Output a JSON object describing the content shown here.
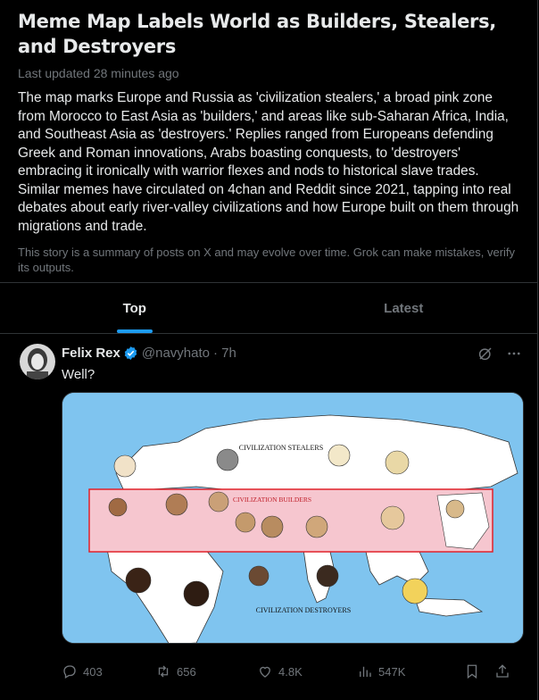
{
  "story": {
    "title": "Meme Map Labels World as Builders, Stealers, and Destroyers",
    "updated": "Last updated 28 minutes ago",
    "summary": "The map marks Europe and Russia as 'civilization stealers,' a broad pink zone from Morocco to East Asia as 'builders,' and areas like sub-Saharan Africa, India, and Southeast Asia as 'destroyers.' Replies ranged from Europeans defending Greek and Roman innovations, Arabs boasting conquests, to 'destroyers' embracing it ironically with warrior flexes and nods to historical slave trades. Similar memes have circulated on 4chan and Reddit since 2021, tapping into real debates about early river-valley civilizations and how Europe built on them through migrations and trade.",
    "disclaimer": "This story is a summary of posts on X and may evolve over time. Grok can make mistakes, verify its outputs."
  },
  "tabs": [
    {
      "label": "Top",
      "active": true
    },
    {
      "label": "Latest",
      "active": false
    }
  ],
  "post": {
    "author": "Felix Rex",
    "handle": "@navyhato",
    "time": "· 7h",
    "text": "Well?",
    "map_labels": {
      "stealers": "CIVILIZATION STEALERS",
      "builders": "CIVILIZATION BUILDERS",
      "destroyers": "CIVILIZATION DESTROYERS"
    },
    "stats": {
      "replies": "403",
      "reposts": "656",
      "likes": "4.8K",
      "views": "547K"
    }
  },
  "colors": {
    "accent": "#1d9bf0",
    "verified": "#1d9bf0",
    "ocean": "#7fc4ef",
    "builder_zone": "#f6c6cf",
    "builder_border": "#e0222a"
  },
  "icons": [
    "verified-badge-icon",
    "grok-icon",
    "more-icon",
    "reply-icon",
    "repost-icon",
    "like-icon",
    "views-icon",
    "bookmark-icon",
    "share-icon"
  ]
}
